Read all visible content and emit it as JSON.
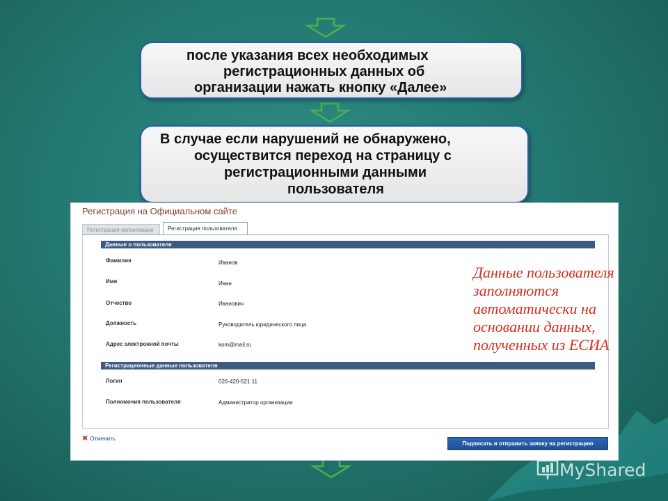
{
  "box1": {
    "lines": [
      "после указания всех необходимых",
      "регистрационных данных об",
      "организации нажать кнопку «Далее»"
    ]
  },
  "box2": {
    "lines": [
      "В случае если нарушений не обнаружено,",
      "осуществится переход на страницу с",
      "регистрационными данными",
      "пользователя"
    ]
  },
  "panel": {
    "title": "Регистрация на Официальном сайте",
    "tabs": [
      "Регистрация организации",
      "Регистрация пользователя"
    ],
    "active_tab": "Регистрация пользователя",
    "section1": {
      "header": "Данные о пользователе",
      "fields": [
        {
          "label": "Фамилия",
          "value": "Иванов"
        },
        {
          "label": "Имя",
          "value": "Иван"
        },
        {
          "label": "Отчество",
          "value": "Иванович"
        },
        {
          "label": "Должность",
          "value": "Руководитель юридического лица"
        },
        {
          "label": "Адрес электронной почты",
          "value": "kom@mail.ru"
        }
      ]
    },
    "section2": {
      "header": "Регистрационные данные пользователя",
      "fields": [
        {
          "label": "Логин",
          "value": "026-420-521 11"
        },
        {
          "label": "Полномочия пользователя",
          "value": "Администратор организации"
        }
      ]
    },
    "cancel_label": "Отменить",
    "submit_label": "Подписать и отправить заявку на регистрацию"
  },
  "note": {
    "lines": [
      "Данные пользователя",
      "заполняются",
      "автоматически на",
      "основании данных,",
      "полученных из ЕСИА"
    ],
    "color": "#d42e1e"
  },
  "watermark": {
    "text": "MyShared"
  }
}
